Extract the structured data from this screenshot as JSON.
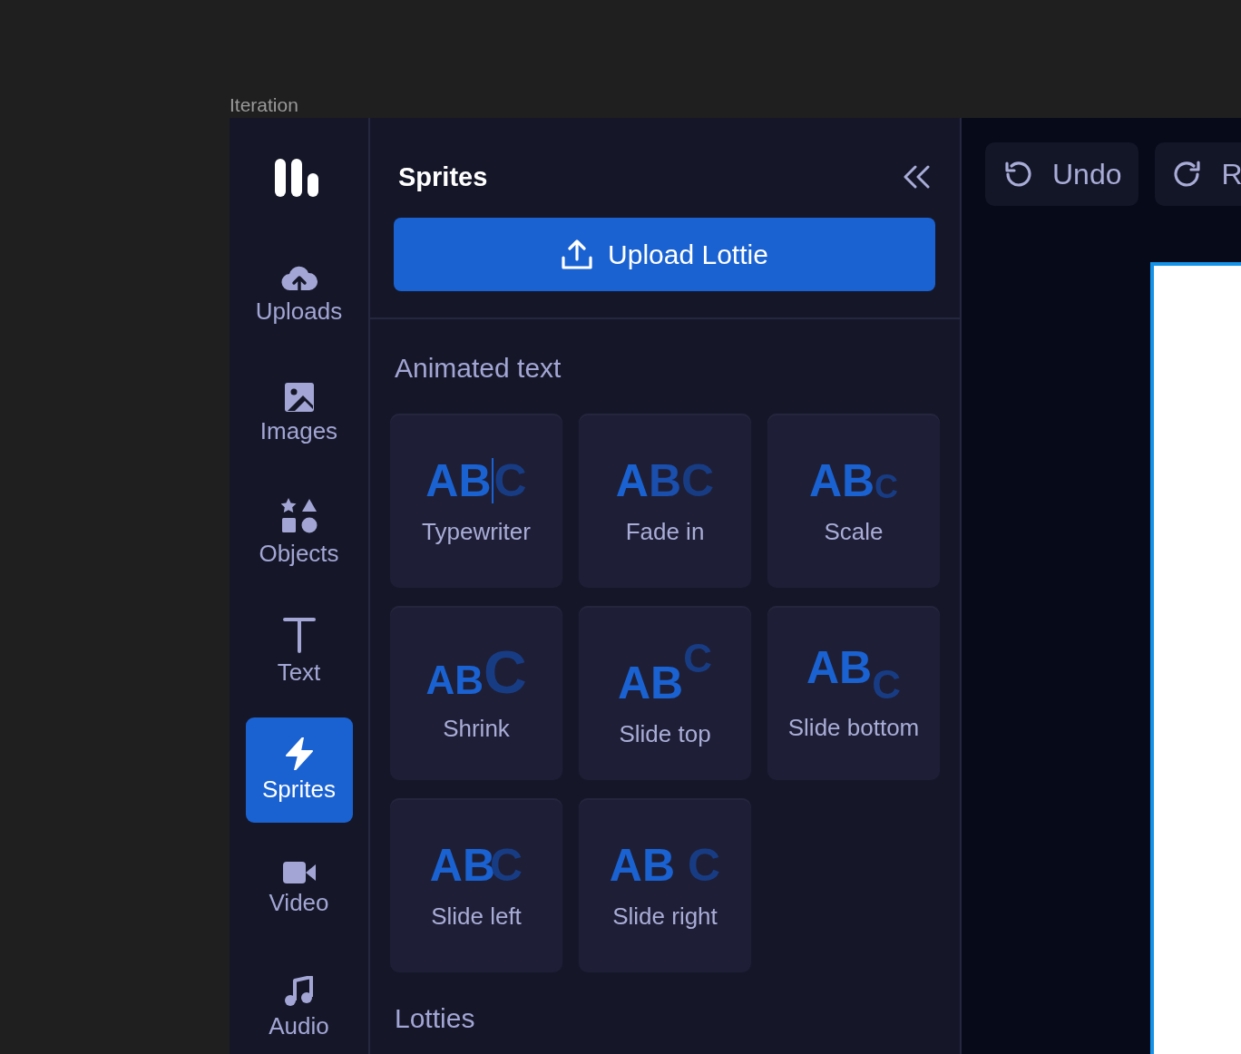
{
  "frame_label": "Iteration",
  "sidebar": {
    "items": [
      {
        "kind": "uploads",
        "label": "Uploads",
        "selected": false
      },
      {
        "kind": "images",
        "label": "Images",
        "selected": false
      },
      {
        "kind": "objects",
        "label": "Objects",
        "selected": false
      },
      {
        "kind": "text",
        "label": "Text",
        "selected": false
      },
      {
        "kind": "sprites",
        "label": "Sprites",
        "selected": true
      },
      {
        "kind": "video",
        "label": "Video",
        "selected": false
      },
      {
        "kind": "audio",
        "label": "Audio",
        "selected": false
      }
    ]
  },
  "panel": {
    "title": "Sprites",
    "upload_button": "Upload Lottie",
    "section": "Animated text",
    "cards": [
      {
        "kind": "typewriter",
        "preview": "ABC",
        "label": "Typewriter"
      },
      {
        "kind": "fade",
        "preview": "ABC",
        "label": "Fade in"
      },
      {
        "kind": "scale",
        "preview": "ABC",
        "label": "Scale"
      },
      {
        "kind": "shrink",
        "preview": "ABC",
        "label": "Shrink"
      },
      {
        "kind": "slide-top",
        "preview": "ABC",
        "label": "Slide top"
      },
      {
        "kind": "slide-bottom",
        "preview": "ABC",
        "label": "Slide bottom"
      },
      {
        "kind": "slide-left",
        "preview": "ABC",
        "label": "Slide left"
      },
      {
        "kind": "slide-right",
        "preview": "ABC",
        "label": "Slide right"
      }
    ],
    "next_section": "Lotties"
  },
  "toolbar": [
    {
      "kind": "undo",
      "label": "Undo"
    },
    {
      "kind": "redo",
      "label": "R"
    }
  ]
}
